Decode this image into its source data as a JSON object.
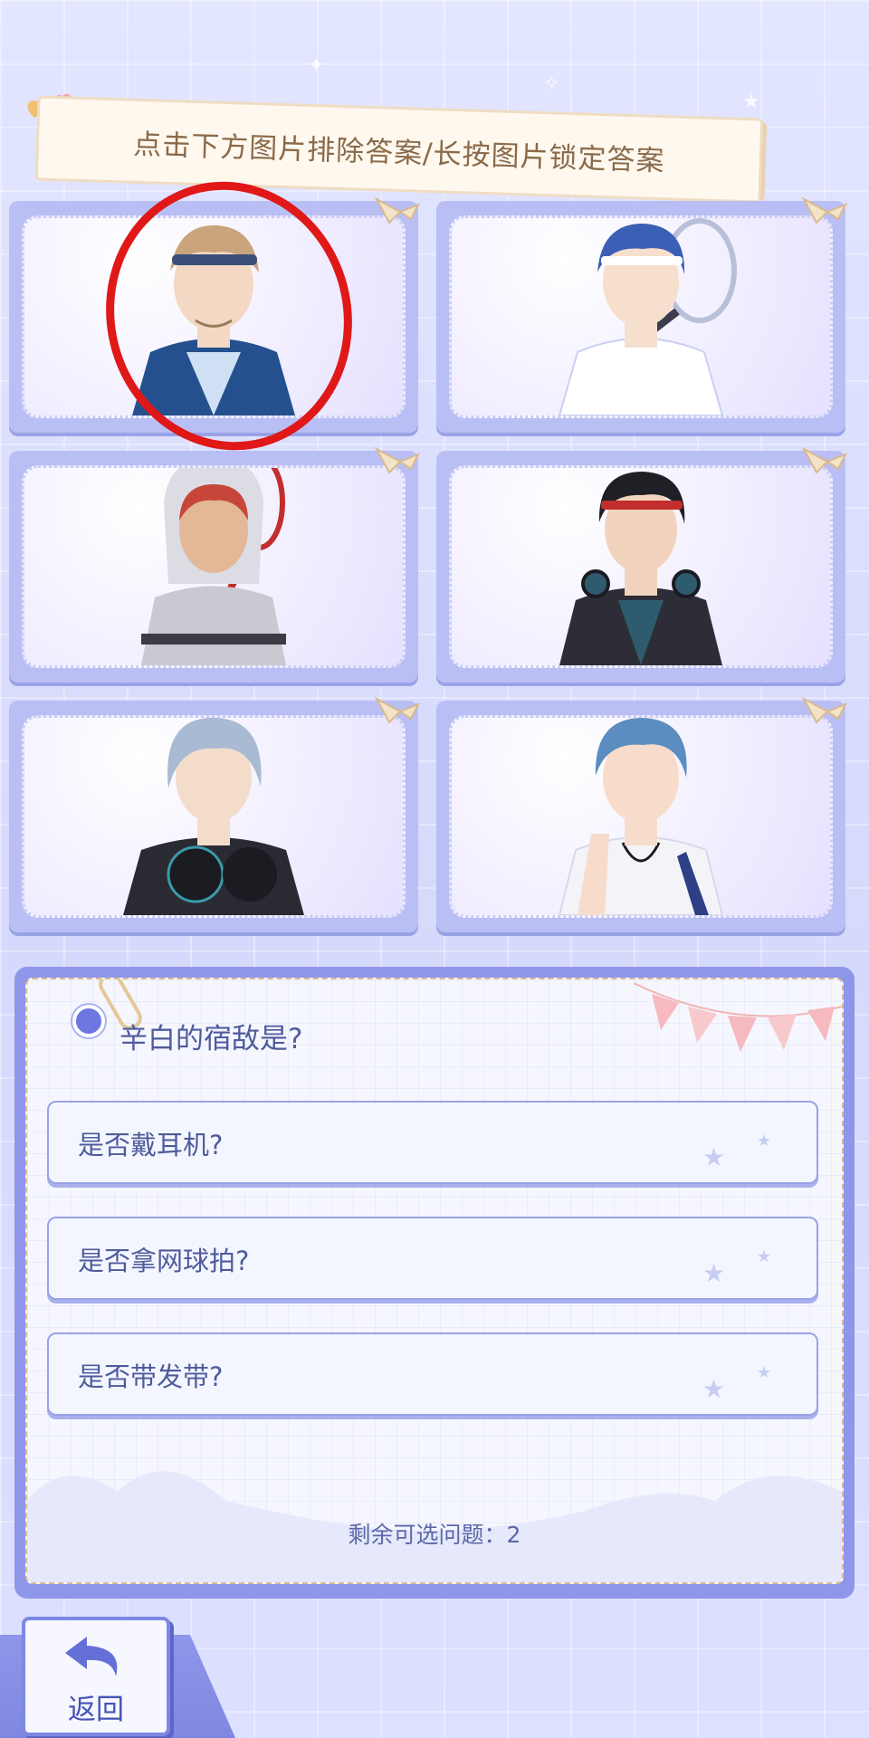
{
  "instruction": "点击下方图片排除答案/长按图片锁定答案",
  "characters": [
    {
      "name": "headband-blond",
      "hair": "#c9a47c",
      "skin": "#f3d8c3",
      "outfit": "#24508e",
      "accent": "#3a4f7a"
    },
    {
      "name": "blue-hair-racket",
      "hair": "#3b5fb5",
      "skin": "#f6dfcd",
      "outfit": "#ffffff",
      "accent": "#c7d0f2"
    },
    {
      "name": "red-hair-hoodie",
      "hair": "#c6463a",
      "skin": "#e3b896",
      "outfit": "#c9c9d2",
      "accent": "#c22d2d"
    },
    {
      "name": "black-hair-headphones",
      "hair": "#1f1f25",
      "skin": "#f2d3bd",
      "outfit": "#2c2d36",
      "accent": "#2f5b6e"
    },
    {
      "name": "silver-hair-headphones",
      "hair": "#a9bad3",
      "skin": "#f4dccb",
      "outfit": "#2a2a33",
      "accent": "#1b1b22"
    },
    {
      "name": "blue-hair-wink",
      "hair": "#5b8dc0",
      "skin": "#f7dccb",
      "outfit": "#f4f4f8",
      "accent": "#2f3f86"
    }
  ],
  "question": {
    "title": "辛白的宿敌是?",
    "options": [
      "是否戴耳机?",
      "是否拿网球拍?",
      "是否带发带?"
    ],
    "remaining": "剩余可选问题：2"
  },
  "back_label": "返回",
  "colors": {
    "accent": "#8e96ea",
    "text": "#4e5b9c",
    "mark": "#e01818"
  }
}
